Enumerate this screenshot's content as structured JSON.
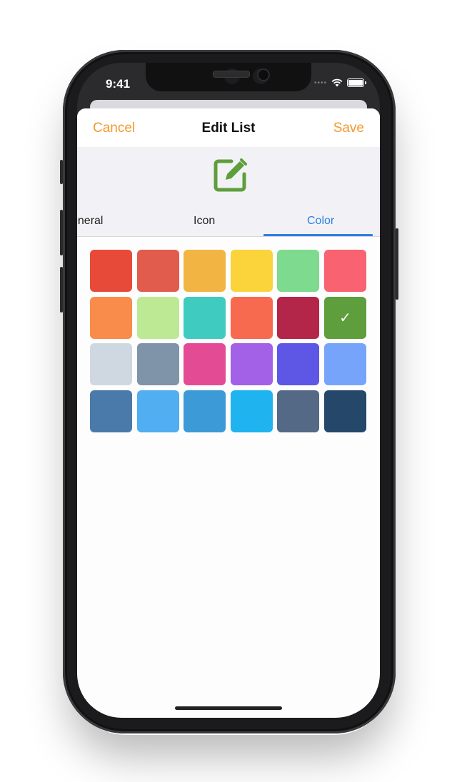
{
  "status_bar": {
    "time": "9:41"
  },
  "nav": {
    "cancel": "Cancel",
    "title": "Edit List",
    "save": "Save"
  },
  "list_icon": {
    "name": "edit-square-icon",
    "color": "#5e9e3c"
  },
  "tabs": [
    {
      "label": "eneral",
      "selected": false
    },
    {
      "label": "Icon",
      "selected": false
    },
    {
      "label": "Color",
      "selected": true
    }
  ],
  "accent_color": "#f2992e",
  "tab_accent_color": "#2f7fe0",
  "swatches": [
    "#e84a3a",
    "#e15c4d",
    "#f2b442",
    "#fbd33a",
    "#7dda8e",
    "#f96270",
    "#f98c4a",
    "#bde994",
    "#3fcbbf",
    "#f86a50",
    "#b4254a",
    "#5e9e3c",
    "#cfd7e1",
    "#7f93a9",
    "#e44b95",
    "#a261e6",
    "#5e57e6",
    "#77a4fb",
    "#4a7aa9",
    "#50aef1",
    "#3c9ad7",
    "#1fb3ef",
    "#536985",
    "#25476a"
  ],
  "selected_swatch_index": 11,
  "check_glyph": "✓"
}
